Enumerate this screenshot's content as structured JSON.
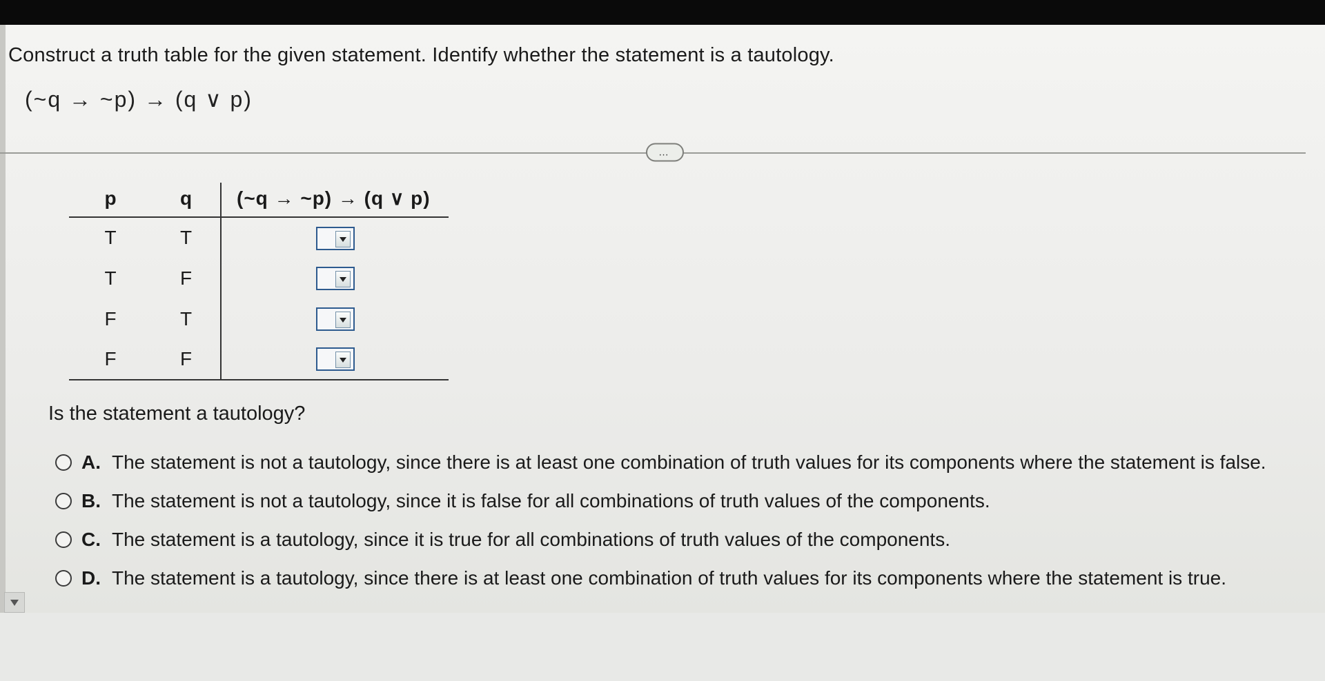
{
  "instruction": "Construct a truth table for the given statement. Identify whether the statement is a tautology.",
  "formula": "(~q → ~p) → (q ∨ p)",
  "divider_label": "…",
  "table": {
    "headers": {
      "p": "p",
      "q": "q",
      "expr": "(~q → ~p) → (q ∨ p)"
    },
    "rows": [
      {
        "p": "T",
        "q": "T",
        "val": ""
      },
      {
        "p": "T",
        "q": "F",
        "val": ""
      },
      {
        "p": "F",
        "q": "T",
        "val": ""
      },
      {
        "p": "F",
        "q": "F",
        "val": ""
      }
    ]
  },
  "question2": "Is the statement a tautology?",
  "options": [
    {
      "label": "A.",
      "text": "The statement is not a tautology, since there is at least one combination of truth values for its components where the statement is false."
    },
    {
      "label": "B.",
      "text": "The statement is not a tautology, since it is false for all combinations of truth values of the components."
    },
    {
      "label": "C.",
      "text": "The statement is a tautology, since it is true for all combinations of truth values of the components."
    },
    {
      "label": "D.",
      "text": "The statement is a tautology, since there is at least one combination of truth values for its components where the statement is true."
    }
  ]
}
